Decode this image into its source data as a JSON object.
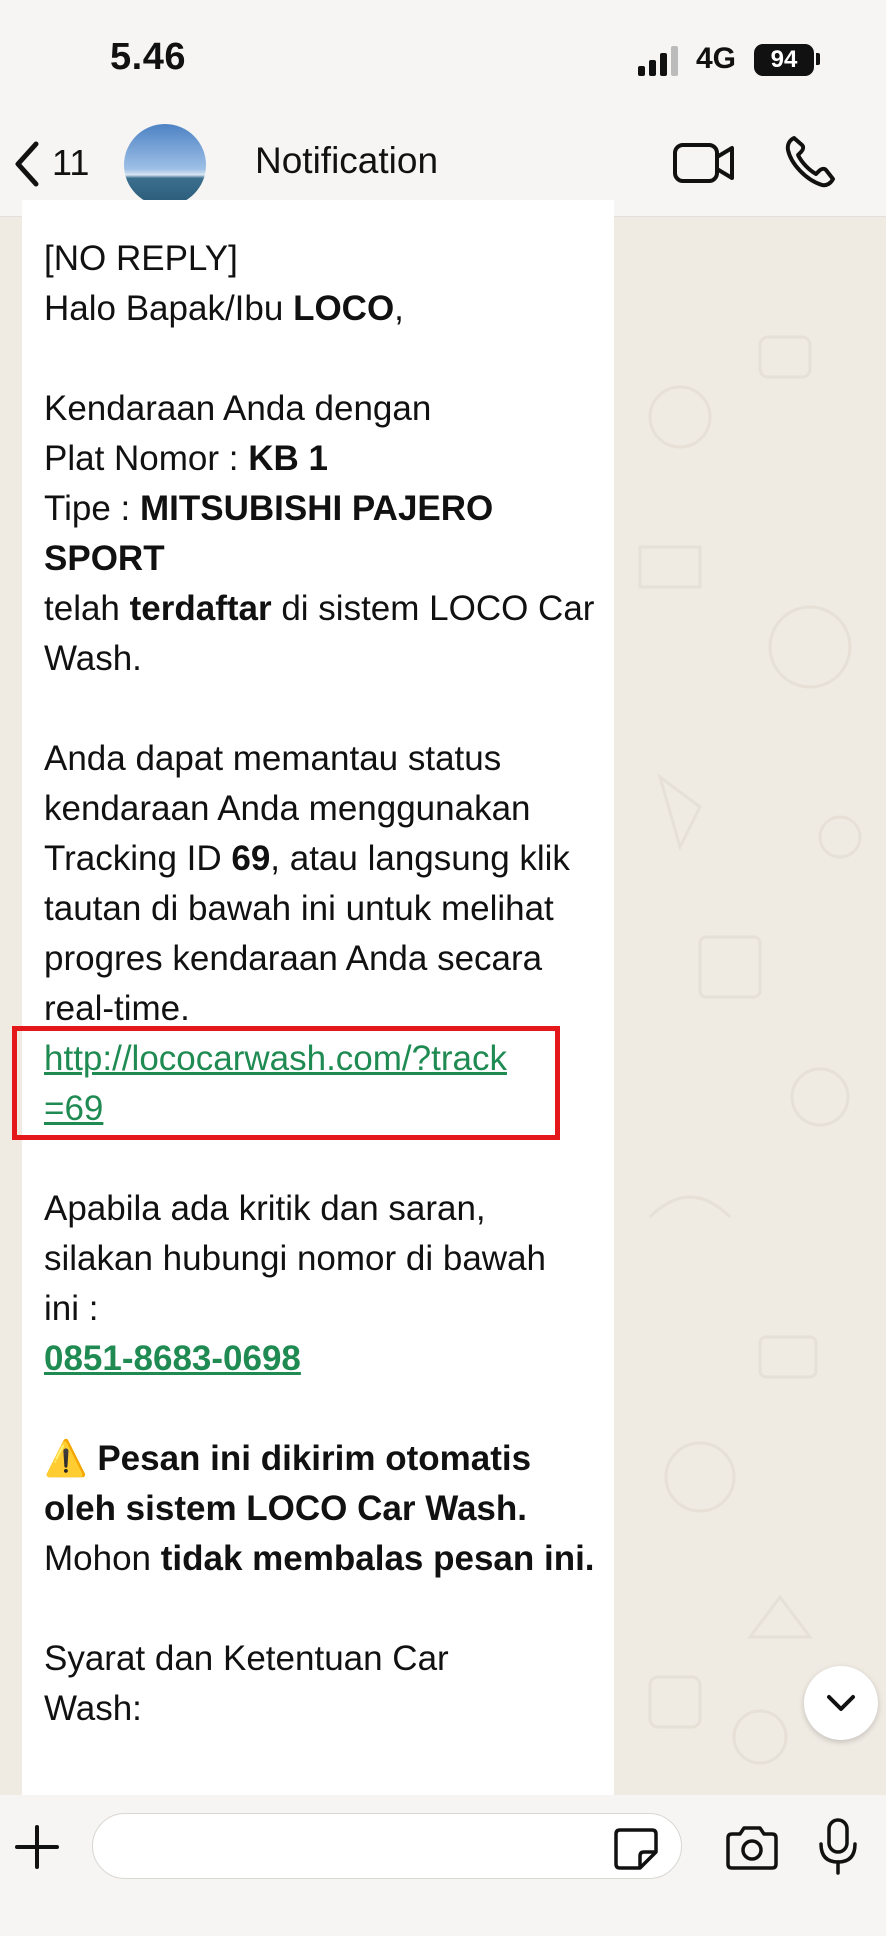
{
  "status_bar": {
    "time": "5.46",
    "network": "4G",
    "battery": "94"
  },
  "header": {
    "back_count": "11",
    "contact_name": "Notification",
    "icons": [
      "chevron-left-icon",
      "video-call-icon",
      "phone-icon"
    ]
  },
  "message": {
    "l1": "[NO REPLY]",
    "l2a": "Halo Bapak/Ibu ",
    "l2b": "LOCO",
    "l2c": ",",
    "l3": "Kendaraan Anda dengan",
    "l4a": "Plat Nomor : ",
    "l4b": "KB 1",
    "l5a": "Tipe : ",
    "l5b": "MITSUBISHI PAJERO SPORT",
    "l6a": "telah ",
    "l6b": "terdaftar",
    "l6c": " di sistem LOCO Car Wash.",
    "p2a": "Anda dapat memantau status kendaraan Anda menggunakan Tracking ID ",
    "p2b": "69",
    "p2c": ", atau langsung klik tautan di bawah ini untuk melihat progres kendaraan Anda secara real-time.",
    "link": "http://lococarwash.com/?track=69",
    "p3": "Apabila ada kritik dan saran, silakan hubungi nomor di bawah ini :",
    "phone": "0851-8683-0698",
    "warn_icon": "⚠️",
    "p4a": " Pesan ini dikirim otomatis oleh sistem LOCO Car Wash.",
    "p4b": " Mohon ",
    "p4c": "tidak membalas pesan ini.",
    "p5": "Syarat dan Ketentuan Car Wash:"
  },
  "colors": {
    "link": "#1f8b52",
    "highlight_box": "#e4171b",
    "chat_bg": "#EFEAE2"
  },
  "composer": {
    "placeholder": "",
    "icons": [
      "plus-icon",
      "sticker-icon",
      "camera-icon",
      "microphone-icon"
    ]
  }
}
